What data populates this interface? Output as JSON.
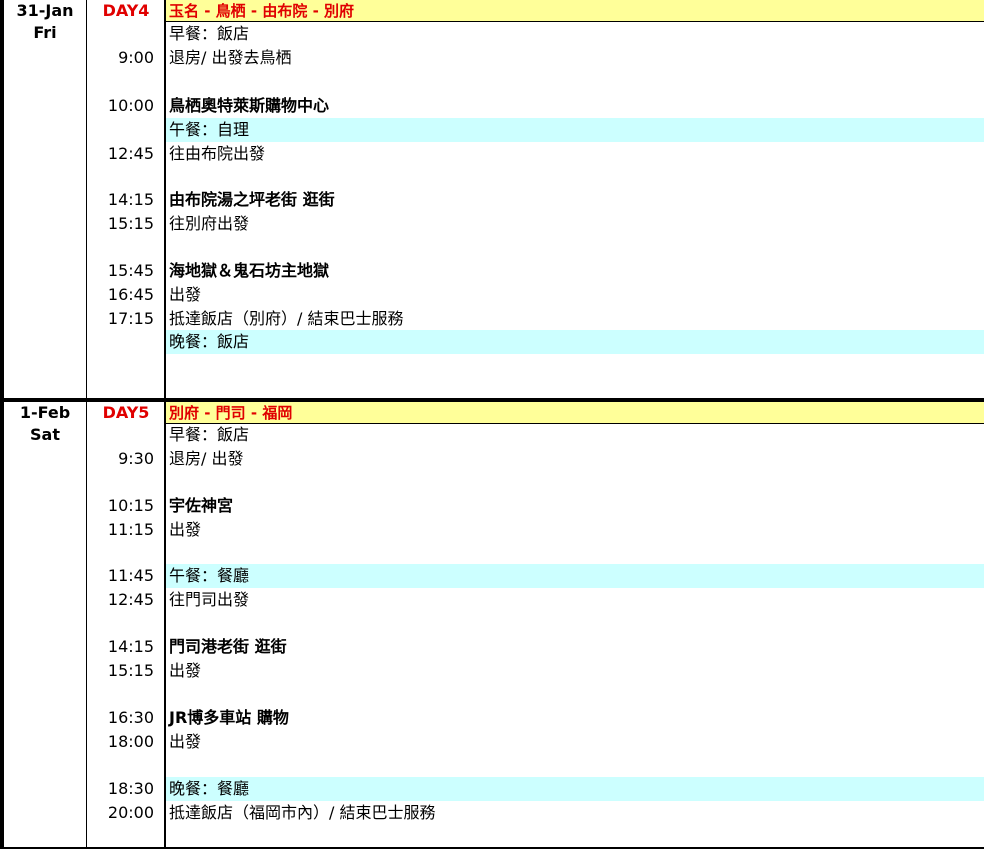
{
  "days": [
    {
      "date": "31-Jan",
      "weekday": "Fri",
      "day_label": "DAY4",
      "route": "玉名 - 鳥栖 - 由布院 - 別府",
      "rows": [
        {
          "time": "",
          "text": "早餐：飯店",
          "style": "plain"
        },
        {
          "time": "9:00",
          "text": "退房/ 出發去鳥栖",
          "style": "plain"
        },
        {
          "time": "10:00",
          "text": "鳥栖奧特萊斯購物中心",
          "style": "bold"
        },
        {
          "time": "",
          "text": "午餐：自理",
          "style": "meal"
        },
        {
          "time": "12:45",
          "text": "往由布院出發",
          "style": "plain"
        },
        {
          "time": "14:15",
          "text": "由布院湯之坪老街 逛街",
          "style": "bold"
        },
        {
          "time": "15:15",
          "text": "往別府出發",
          "style": "plain"
        },
        {
          "time": "15:45",
          "text": "海地獄＆鬼石坊主地獄",
          "style": "bold"
        },
        {
          "time": "16:45",
          "text": "出發",
          "style": "plain"
        },
        {
          "time": "17:15",
          "text": "抵達飯店（別府）/ 結束巴士服務",
          "style": "plain"
        },
        {
          "time": "",
          "text": "晚餐：飯店",
          "style": "meal"
        }
      ]
    },
    {
      "date": "1-Feb",
      "weekday": "Sat",
      "day_label": "DAY5",
      "route": "別府 - 門司 - 福岡",
      "rows": [
        {
          "time": "",
          "text": "早餐：飯店",
          "style": "plain"
        },
        {
          "time": "9:30",
          "text": "退房/ 出發",
          "style": "plain"
        },
        {
          "time": "10:15",
          "text": "宇佐神宮",
          "style": "bold"
        },
        {
          "time": "11:15",
          "text": "出發",
          "style": "plain"
        },
        {
          "time": "11:45",
          "text": "午餐：餐廳",
          "style": "meal"
        },
        {
          "time": "12:45",
          "text": "往門司出發",
          "style": "plain"
        },
        {
          "time": "14:15",
          "text": "門司港老街 逛街",
          "style": "bold"
        },
        {
          "time": "15:15",
          "text": "出發",
          "style": "plain"
        },
        {
          "time": "16:30",
          "text": "JR博多車站 購物",
          "style": "bold"
        },
        {
          "time": "18:00",
          "text": "出發",
          "style": "plain"
        },
        {
          "time": "18:30",
          "text": "晚餐：餐廳",
          "style": "meal"
        },
        {
          "time": "20:00",
          "text": "抵達飯店（福岡市內）/ 結束巴士服務",
          "style": "plain"
        }
      ]
    }
  ]
}
